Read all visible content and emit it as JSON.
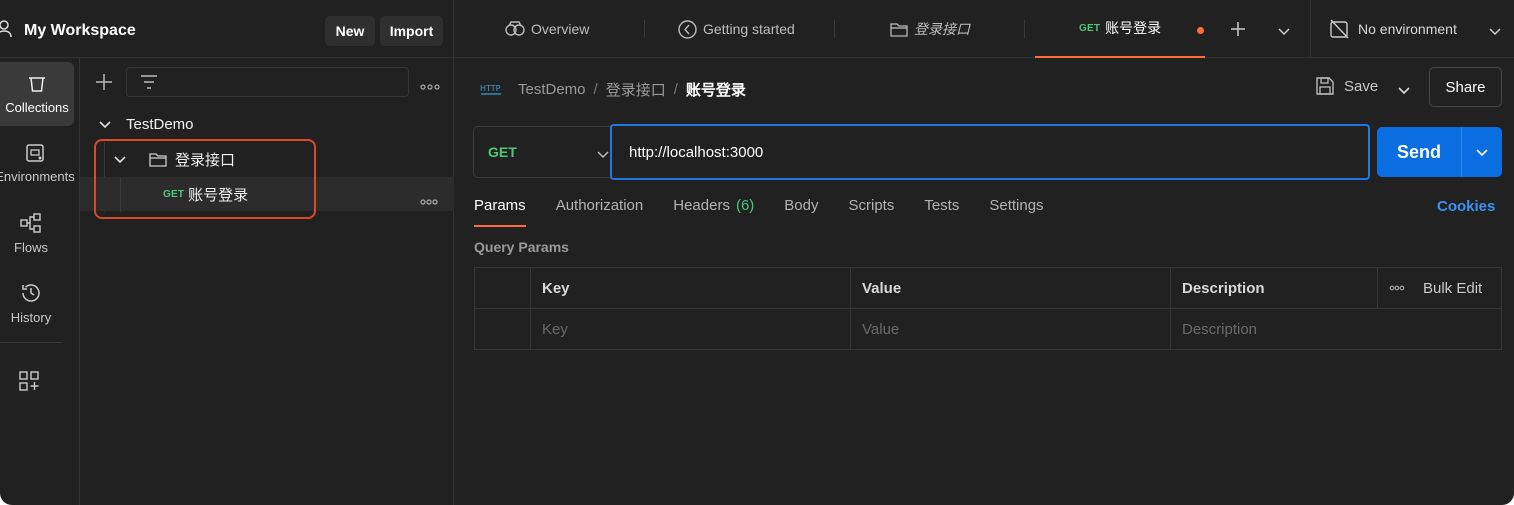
{
  "workspace": {
    "title": "My Workspace",
    "new_label": "New",
    "import_label": "Import"
  },
  "tabs": {
    "overview": "Overview",
    "getting_started": "Getting started",
    "folder": "登录接口",
    "active_method": "GET",
    "active_label": "账号登录"
  },
  "environment": {
    "label": "No environment"
  },
  "rail": {
    "collections": "Collections",
    "environments": "Environments",
    "flows": "Flows",
    "history": "History"
  },
  "sidebar": {
    "collection": "TestDemo",
    "folder": "登录接口",
    "request_method": "GET",
    "request_label": "账号登录"
  },
  "breadcrumb": {
    "collection": "TestDemo",
    "folder": "登录接口",
    "current": "账号登录",
    "sep": "/"
  },
  "toolbar": {
    "save_label": "Save",
    "share_label": "Share"
  },
  "request": {
    "method": "GET",
    "url": "http://localhost:3000",
    "send_label": "Send"
  },
  "request_tabs": {
    "params": "Params",
    "authorization": "Authorization",
    "headers": "Headers",
    "headers_count": "(6)",
    "body": "Body",
    "scripts": "Scripts",
    "tests": "Tests",
    "settings": "Settings",
    "cookies": "Cookies"
  },
  "params": {
    "title": "Query Params",
    "headers": {
      "key": "Key",
      "value": "Value",
      "description": "Description",
      "bulk_edit": "Bulk Edit"
    },
    "placeholders": {
      "key": "Key",
      "value": "Value",
      "description": "Description"
    }
  },
  "colors": {
    "accent": "#ff6c37",
    "send": "#0a6de0",
    "get": "#4ec77c",
    "focus": "#1e78e6",
    "highlight": "#d84a2a"
  }
}
